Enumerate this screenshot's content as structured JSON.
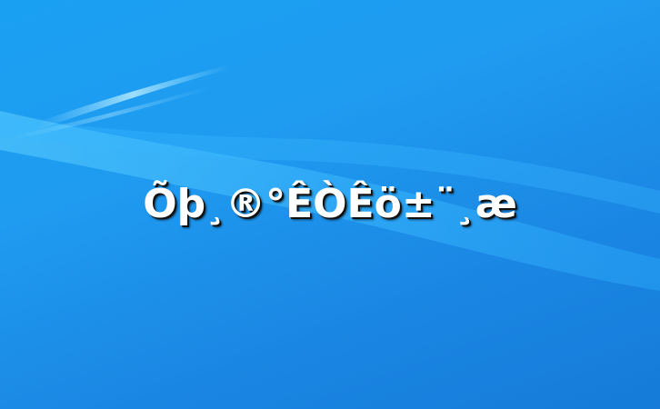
{
  "desktop": {
    "background_colors": [
      "#1aa0f2",
      "#1f9bf0",
      "#1a86e3",
      "#167bd9"
    ],
    "swoosh_color": "#4ec2ff"
  },
  "message": {
    "text": "Õþ¸®°ÊÒÊö±¨¸æ"
  }
}
